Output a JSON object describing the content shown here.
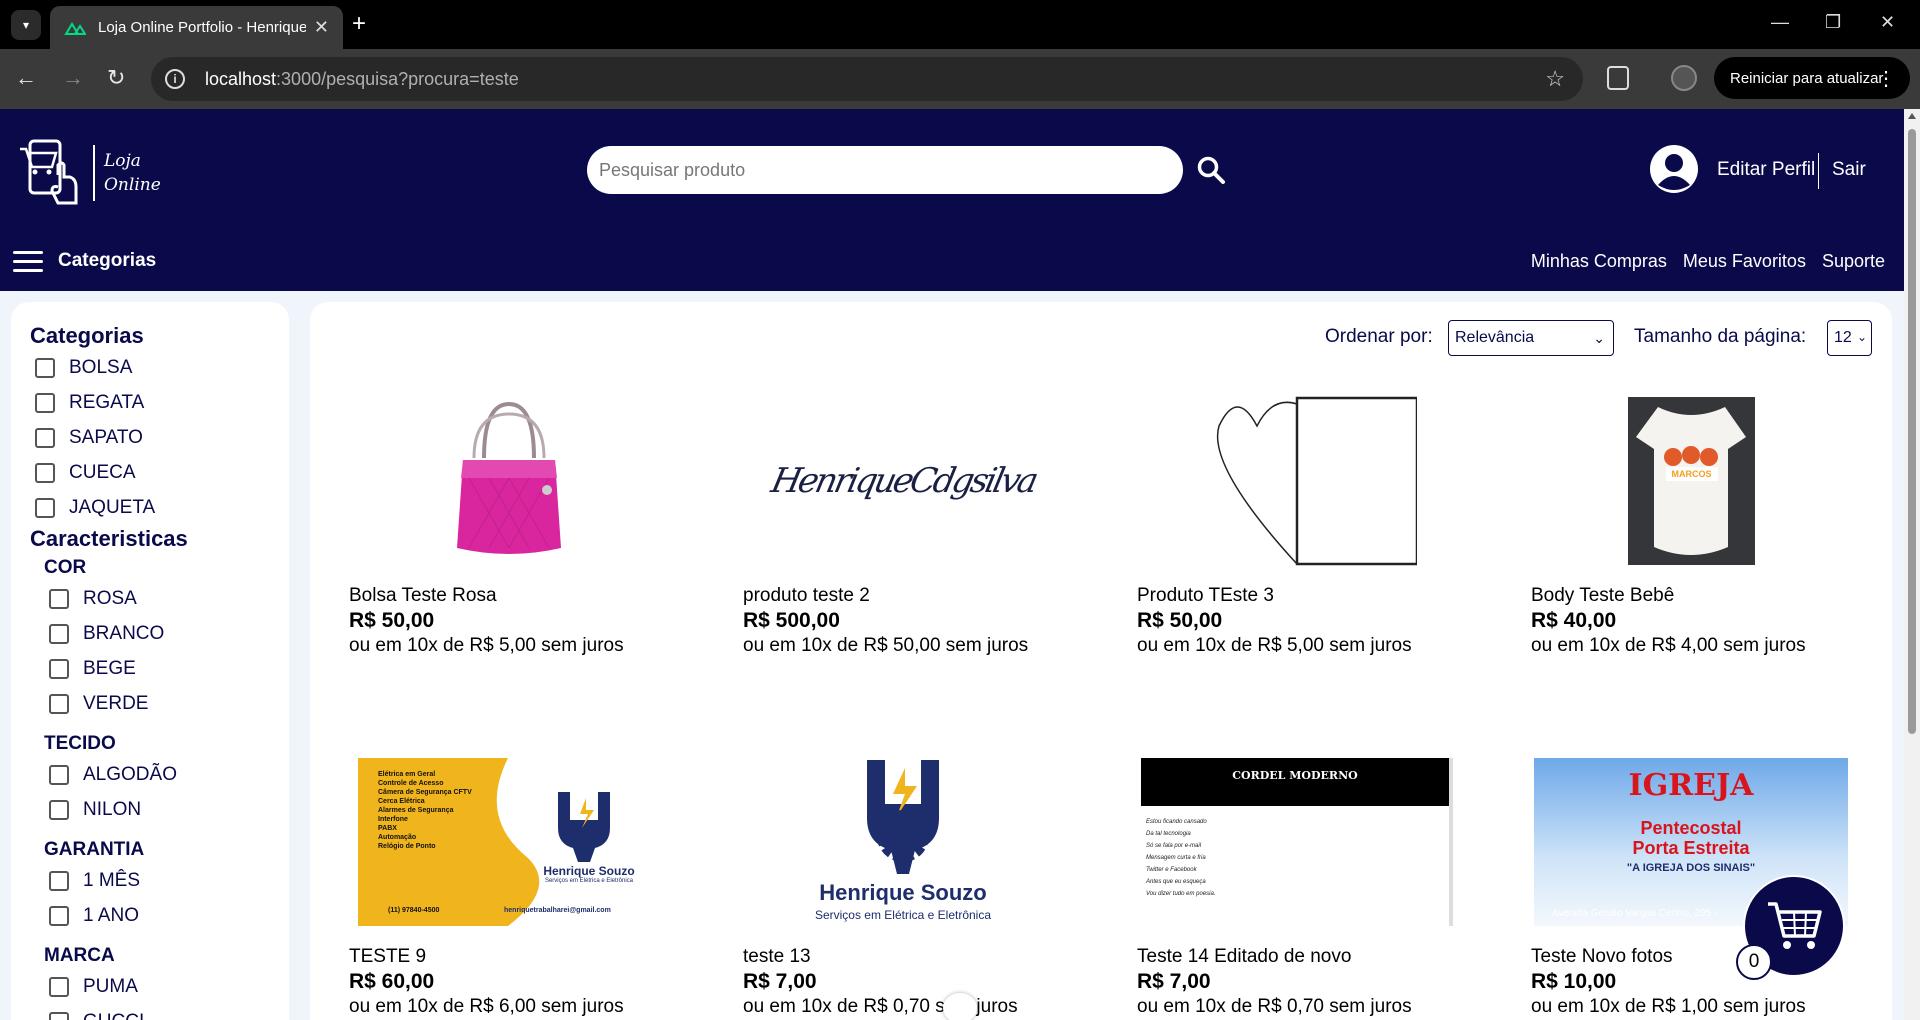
{
  "browser": {
    "tab_title": "Loja Online Portfolio - Henrique",
    "url_host": "localhost",
    "url_rest": ":3000/pesquisa?procura=teste",
    "update_button": "Reiniciar para atualizar"
  },
  "header": {
    "logo_line1": "Loja",
    "logo_line2": "Online",
    "search_placeholder": "Pesquisar produto",
    "edit_profile": "Editar Perfil",
    "logout": "Sair",
    "categories_button": "Categorias",
    "links": [
      "Minhas Compras",
      "Meus Favoritos",
      "Suporte"
    ]
  },
  "sidebar": {
    "categories_title": "Categorias",
    "categories": [
      "BOLSA",
      "REGATA",
      "SAPATO",
      "CUECA",
      "JAQUETA"
    ],
    "features_title": "Caracteristicas",
    "groups": [
      {
        "title": "COR",
        "options": [
          "ROSA",
          "BRANCO",
          "BEGE",
          "VERDE"
        ]
      },
      {
        "title": "TECIDO",
        "options": [
          "ALGODÃO",
          "NILON"
        ]
      },
      {
        "title": "GARANTIA",
        "options": [
          "1 MÊS",
          "1 ANO"
        ]
      },
      {
        "title": "MARCA",
        "options": [
          "PUMA",
          "GUCCI"
        ]
      }
    ]
  },
  "toolbar": {
    "sort_label": "Ordenar por:",
    "sort_value": "Relevância",
    "page_size_label": "Tamanho da página:",
    "page_size_value": "12"
  },
  "products": [
    {
      "name": "Bolsa Teste Rosa",
      "price": "R$ 50,00",
      "installments": "ou em 10x de R$ 5,00 sem juros"
    },
    {
      "name": "produto teste 2",
      "price": "R$ 500,00",
      "installments": "ou em 10x de R$ 50,00 sem juros"
    },
    {
      "name": "Produto TEste 3",
      "price": "R$ 50,00",
      "installments": "ou em 10x de R$ 5,00 sem juros"
    },
    {
      "name": "Body Teste Bebê",
      "price": "R$ 40,00",
      "installments": "ou em 10x de R$ 4,00 sem juros"
    },
    {
      "name": "TESTE 9",
      "price": "R$ 60,00",
      "installments": "ou em 10x de R$ 6,00 sem juros"
    },
    {
      "name": "teste 13",
      "price": "R$ 7,00",
      "installments": "ou em 10x de R$ 0,70 sem juros"
    },
    {
      "name": "Teste 14 Editado de novo",
      "price": "R$ 7,00",
      "installments": "ou em 10x de R$ 0,70 sem juros"
    },
    {
      "name": "Teste Novo fotos",
      "price": "R$ 10,00",
      "installments": "ou em 10x de R$ 1,00 sem juros"
    }
  ],
  "product_images": {
    "signature_text": "HenriqueCdgsilva",
    "brand_name": "Henrique Souzo",
    "brand_tagline": "Serviços em Elétrica e Eletrônica",
    "flyer_services": [
      "Elétrica em Geral",
      "Controle de Acesso",
      "Câmera de Segurança CFTV",
      "Cerca Elétrica",
      "Alarmes de Segurança",
      "Interfone",
      "PABX",
      "Automação",
      "Relógio de Ponto"
    ],
    "flyer_phone": "(11) 97840-4500",
    "flyer_email": "henriquetrabalharei@gmail.com",
    "cordel_title": "CORDEL MODERNO",
    "cordel_lines": [
      "Estou ficando cansado",
      "Da tal tecnologia",
      "Só se fala por e-mail",
      "Mensagem curta e fria",
      "Twitter e Facebook",
      "Antes que eu esqueça",
      "Vou dizer tudo em poesia."
    ],
    "church_title": "IGREJA",
    "church_line2": "Pentecostal",
    "church_line3": "Porta Estreita",
    "church_slogan": "\"A IGREJA DOS SINAIS\"",
    "church_address": "Avenida Getúlio Vargas Centro, 295 -",
    "body_print": "MARCOS"
  },
  "cart": {
    "count": "0"
  },
  "colors": {
    "brand_navy": "#0a0a4b",
    "page_bg": "#f0f4fb",
    "bag_pink": "#d9269f",
    "flyer_yellow": "#f0b41c"
  }
}
